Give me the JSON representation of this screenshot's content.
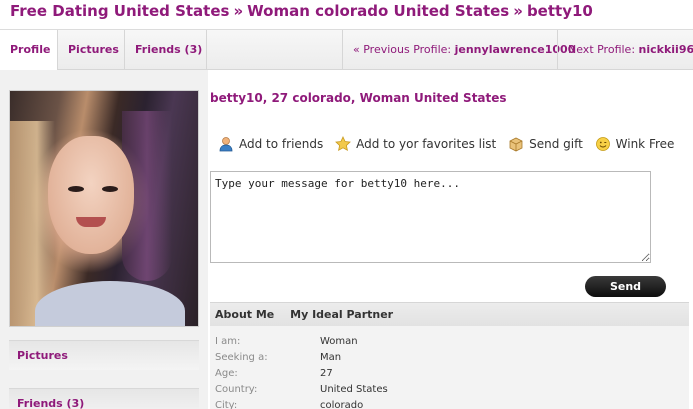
{
  "breadcrumb": {
    "part1": "Free Dating United States",
    "part2": "Woman colorado United States",
    "part3": "betty10",
    "separator": "»"
  },
  "tabs": {
    "profile": "Profile",
    "pictures": "Pictures",
    "friends": "Friends (3)",
    "prev_prefix": "« Previous Profile: ",
    "prev_name": "jennylawrence1000",
    "next_prefix": "Next Profile: ",
    "next_name": "nickkii96",
    "next_suffix": " »"
  },
  "headline": "betty10, 27 colorado, Woman United States",
  "actions": {
    "add_friends": "Add to friends",
    "favorites": "Add to yor favorites list",
    "gift": "Send gift",
    "wink": "Wink Free"
  },
  "message": {
    "placeholder": "Type your message for betty10 here...",
    "send_label": "Send"
  },
  "sidebar": {
    "pictures": "Pictures",
    "friends": "Friends (3)"
  },
  "info": {
    "tab_about": "About Me",
    "tab_partner": "My Ideal Partner",
    "rows": [
      {
        "k": "I am:",
        "v": "Woman"
      },
      {
        "k": "Seeking a:",
        "v": "Man"
      },
      {
        "k": "Age:",
        "v": "27"
      },
      {
        "k": "Country:",
        "v": "United States"
      },
      {
        "k": "City:",
        "v": "colorado"
      }
    ]
  },
  "colors": {
    "accent": "#8f1a7a",
    "send_button": "#111111"
  },
  "icons": {
    "add_friends": "user-icon",
    "favorites": "star-icon",
    "gift": "gift-icon",
    "wink": "smiley-icon"
  }
}
